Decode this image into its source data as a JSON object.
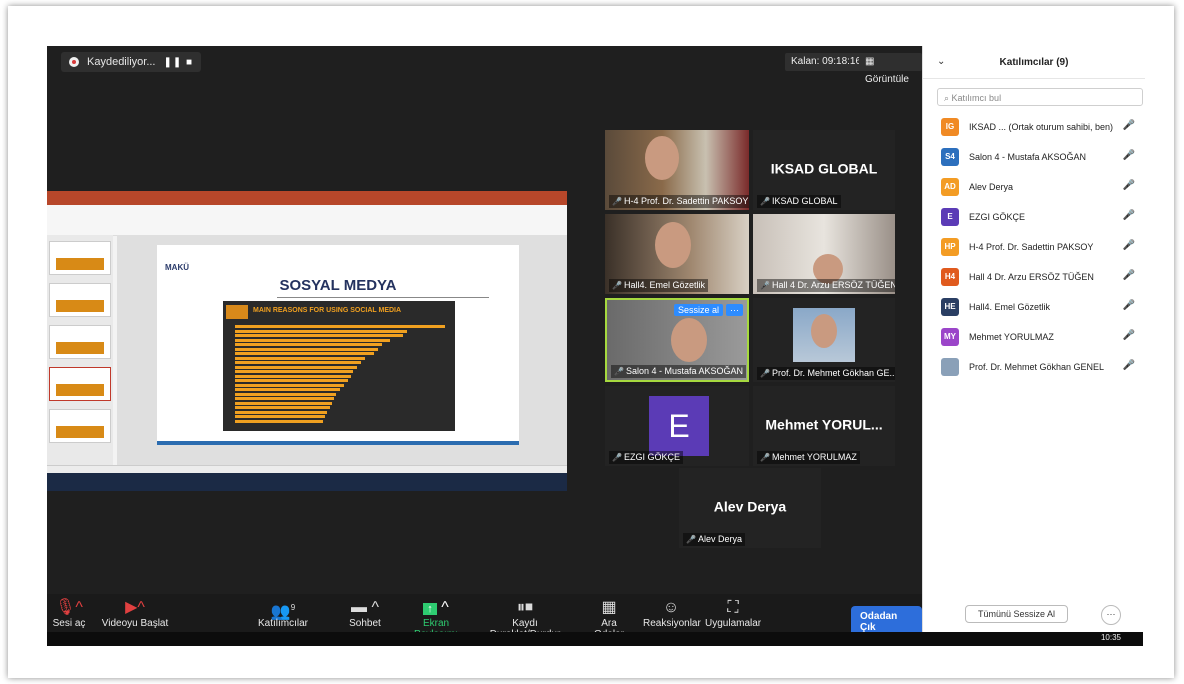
{
  "recording": {
    "label": "Kaydediliyor...",
    "controls": "❚❚ ■"
  },
  "timer": "Kalan: 09:18:16",
  "view_button": "Görüntüle",
  "shared_screen": {
    "slide_title": "SOSYAL MEDYA",
    "logo_text": "MAKÜ",
    "chart_heading": "MAIN REASONS FOR USING SOCIAL MEDIA",
    "bars": [
      1.0,
      0.82,
      0.8,
      0.74,
      0.7,
      0.68,
      0.66,
      0.62,
      0.6,
      0.58,
      0.56,
      0.55,
      0.54,
      0.52,
      0.5,
      0.48,
      0.47,
      0.46,
      0.45,
      0.44,
      0.43,
      0.42
    ]
  },
  "tiles": [
    {
      "name": "H-4 Prof. Dr. Sadettin PAKSOY",
      "kind": "video"
    },
    {
      "name": "IKSAD GLOBAL",
      "kind": "name",
      "big": "IKSAD GLOBAL"
    },
    {
      "name": "Hall4. Emel Gözetlik",
      "kind": "video"
    },
    {
      "name": "Hall 4 Dr. Arzu ERSÖZ TÜĞEN",
      "kind": "video"
    },
    {
      "name": "Salon 4 - Mustafa AKSOĞAN",
      "kind": "video",
      "mute_chip": "Sessize al",
      "more_chip": "···"
    },
    {
      "name": "Prof. Dr. Mehmet Gökhan GE...",
      "kind": "video"
    },
    {
      "name": "EZGI GÖKÇE",
      "kind": "avatar",
      "letter": "E"
    },
    {
      "name": "Mehmet YORULMAZ",
      "kind": "name",
      "big": "Mehmet  YORUL..."
    },
    {
      "name": "Alev Derya",
      "kind": "name",
      "big": "Alev Derya"
    }
  ],
  "toolbar": {
    "mute": "Sesi aç",
    "video": "Videoyu Başlat",
    "participants": "Katılımcılar",
    "participants_count": "9",
    "chat": "Sohbet",
    "share": "Ekran Paylaşımı",
    "record": "Kaydı Duraklat/Durdur",
    "breakout": "Ara Odalar",
    "reactions": "Reaksiyonlar",
    "apps": "Uygulamalar",
    "leave": "Odadan Çık"
  },
  "sidebar": {
    "title": "Katılımcılar (9)",
    "search_placeholder": "Katılımcı bul",
    "participants": [
      {
        "initials": "IG",
        "color": "#f08a24",
        "name": "IKSAD ... (Ortak oturum sahibi, ben)"
      },
      {
        "initials": "S4",
        "color": "#2c6fbd",
        "name": "Salon 4 - Mustafa AKSOĞAN"
      },
      {
        "initials": "AD",
        "color": "#f39c24",
        "name": "Alev Derya"
      },
      {
        "initials": "E",
        "color": "#5b3bb6",
        "name": "EZGI GÖKÇE"
      },
      {
        "initials": "HP",
        "color": "#f39c24",
        "name": "H-4 Prof. Dr. Sadettin PAKSOY"
      },
      {
        "initials": "H4",
        "color": "#e05a1e",
        "name": "Hall 4 Dr. Arzu ERSÖZ TÜĞEN"
      },
      {
        "initials": "HE",
        "color": "#2a3e63",
        "name": "Hall4. Emel Gözetlik"
      },
      {
        "initials": "MY",
        "color": "#9b45c9",
        "name": "Mehmet YORULMAZ"
      },
      {
        "initials": "",
        "color": "#8aa0b8",
        "name": "Prof. Dr. Mehmet Gökhan GENEL"
      }
    ],
    "mute_all": "Tümünü Sessize Al",
    "more": "···"
  },
  "taskbar_clock": "10:35"
}
